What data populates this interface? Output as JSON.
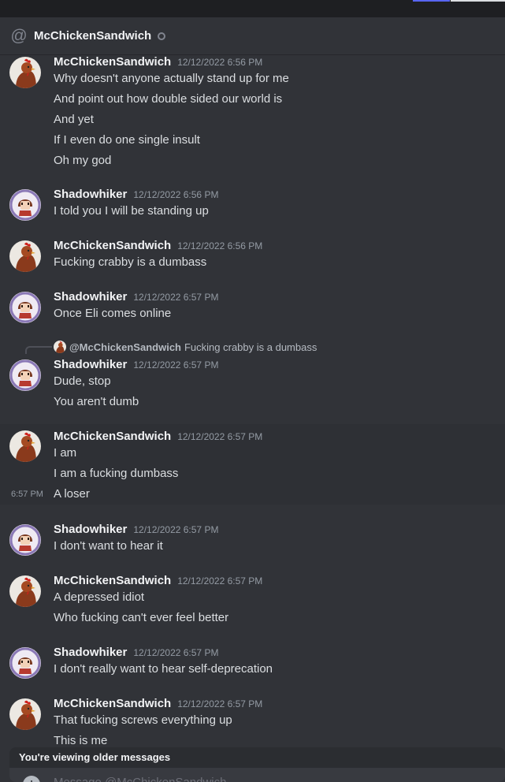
{
  "header": {
    "title": "McChickenSandwich",
    "at_icon": "@"
  },
  "colors": {
    "background": "#313338",
    "accent": "#5865f2"
  },
  "messages": [
    {
      "user": "McChickenSandwich",
      "avatar": "rooster",
      "time": "12/12/2022 6:56 PM",
      "lines": [
        "Why doesn't anyone actually stand up for me",
        "And point out how double sided our world is",
        "And yet",
        "If I even do one single insult",
        "Oh my god"
      ]
    },
    {
      "user": "Shadowhiker",
      "avatar": "girl",
      "time": "12/12/2022 6:56 PM",
      "lines": [
        "I told you I will be standing up"
      ]
    },
    {
      "user": "McChickenSandwich",
      "avatar": "rooster",
      "time": "12/12/2022 6:56 PM",
      "lines": [
        "Fucking crabby is a dumbass"
      ]
    },
    {
      "user": "Shadowhiker",
      "avatar": "girl",
      "time": "12/12/2022 6:57 PM",
      "lines": [
        "Once Eli comes online"
      ]
    },
    {
      "user": "Shadowhiker",
      "avatar": "girl",
      "time": "12/12/2022 6:57 PM",
      "reply": {
        "user": "@McChickenSandwich",
        "text": "Fucking crabby is a dumbass"
      },
      "lines": [
        "Dude, stop",
        "You aren't dumb"
      ]
    },
    {
      "user": "McChickenSandwich",
      "avatar": "rooster",
      "time": "12/12/2022 6:57 PM",
      "hover_time": "6:57 PM",
      "lines": [
        "I am",
        "I am a fucking dumbass",
        "A loser"
      ]
    },
    {
      "user": "Shadowhiker",
      "avatar": "girl",
      "time": "12/12/2022 6:57 PM",
      "lines": [
        "I don't want to hear it"
      ]
    },
    {
      "user": "McChickenSandwich",
      "avatar": "rooster",
      "time": "12/12/2022 6:57 PM",
      "lines": [
        "A depressed idiot",
        "Who fucking can't ever feel better"
      ]
    },
    {
      "user": "Shadowhiker",
      "avatar": "girl",
      "time": "12/12/2022 6:57 PM",
      "lines": [
        "I don't really want to hear self-deprecation"
      ]
    },
    {
      "user": "McChickenSandwich",
      "avatar": "rooster",
      "time": "12/12/2022 6:57 PM",
      "lines": [
        "That fucking screws everything up",
        "This is me"
      ]
    }
  ],
  "older_banner": "You're viewing older messages",
  "composer": {
    "placeholder": "Message @McChickenSandwich"
  }
}
